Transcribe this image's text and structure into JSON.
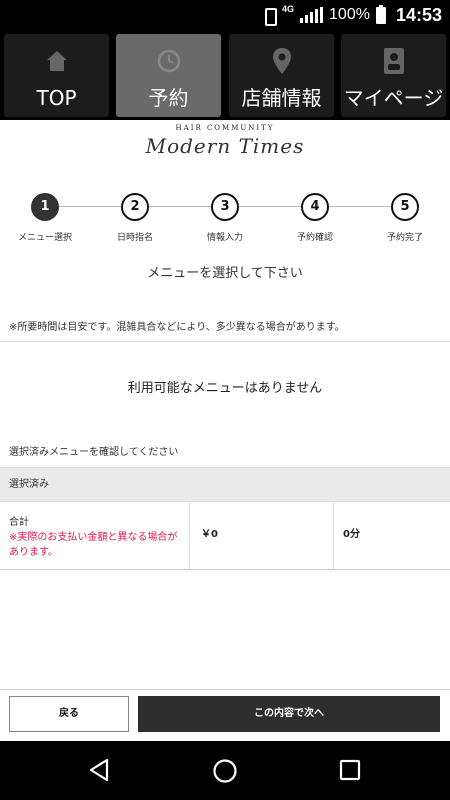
{
  "status_bar": {
    "network": "4G",
    "battery_percent": "100%",
    "time": "14:53"
  },
  "nav": {
    "items": [
      {
        "label": "TOP",
        "icon": "home-icon",
        "active": false
      },
      {
        "label": "予約",
        "icon": "clock-icon",
        "active": true
      },
      {
        "label": "店舗情報",
        "icon": "location-pin-icon",
        "active": false
      },
      {
        "label": "マイページ",
        "icon": "badge-icon",
        "active": false
      }
    ]
  },
  "logo": {
    "top": "HAIR COMMUNITY",
    "main": "Modern Times"
  },
  "steps": [
    {
      "number": "1",
      "label": "メニュー選択",
      "current": true
    },
    {
      "number": "2",
      "label": "日時指名",
      "current": false
    },
    {
      "number": "3",
      "label": "情報入力",
      "current": false
    },
    {
      "number": "4",
      "label": "予約確認",
      "current": false
    },
    {
      "number": "5",
      "label": "予約完了",
      "current": false
    }
  ],
  "main": {
    "title": "メニューを選択して下さい",
    "note": "※所要時間は目安です。混雑具合などにより、多少異なる場合があります。",
    "empty_message": "利用可能なメニューはありません",
    "confirm_prompt": "選択済みメニューを確認してください",
    "selected_header": "選択済み",
    "total_label": "合計",
    "total_warning": "※実際のお支払い金額と異なる場合があります。",
    "total_price": "￥0",
    "total_duration": "0分"
  },
  "buttons": {
    "back": "戻る",
    "next": "この内容で次へ"
  },
  "system_nav": {
    "back_icon": "triangle-back-icon",
    "home_icon": "circle-home-icon",
    "recents_icon": "square-recents-icon"
  }
}
